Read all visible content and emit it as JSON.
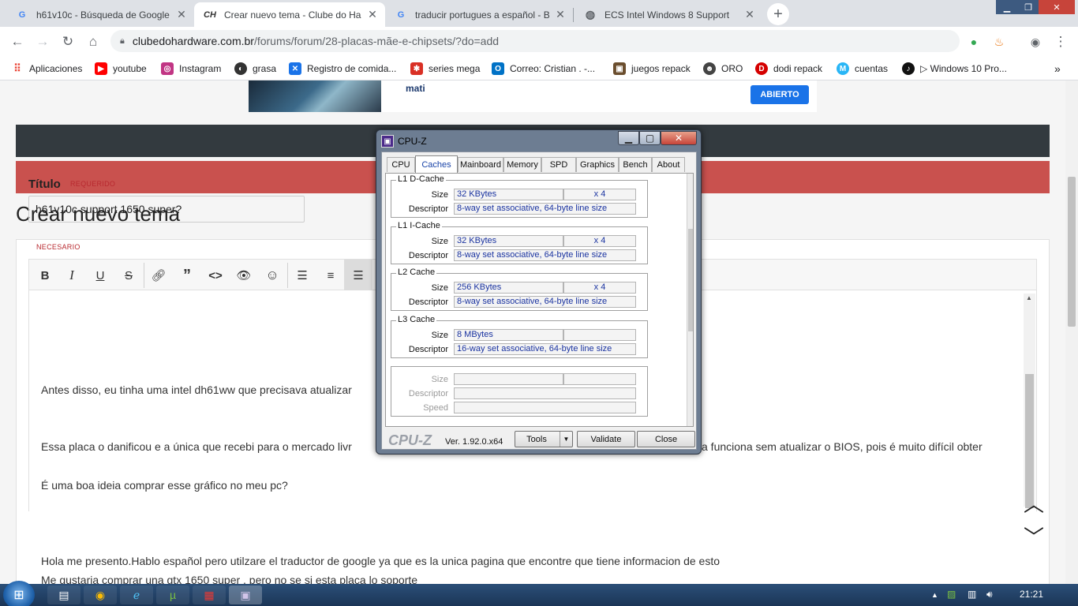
{
  "browser": {
    "tabs": [
      {
        "title": "h61v10c - Búsqueda de Google",
        "icon": "google-icon"
      },
      {
        "title": "Crear nuevo tema - Clube do Hardware",
        "icon": "clube-hardware-icon",
        "fav": "CH"
      },
      {
        "title": "traducir portugues a español - Bu",
        "icon": "google-icon"
      },
      {
        "title": "ECS Intel Windows 8 Support",
        "icon": "globe-icon"
      }
    ],
    "url_host": "clubedohardware.com.br",
    "url_path": "/forums/forum/28-placas-mãe-e-chipsets/?do=add",
    "bookmarks": [
      {
        "label": "Aplicaciones",
        "color": "#ea4335"
      },
      {
        "label": "youtube",
        "color": "#ff0000"
      },
      {
        "label": "Instagram",
        "color": "#c13584"
      },
      {
        "label": "grasa",
        "color": "#333333"
      },
      {
        "label": "Registro de comida...",
        "color": "#1a73e8"
      },
      {
        "label": "series mega",
        "color": "#d93025"
      },
      {
        "label": "Correo: Cristian . -...",
        "color": "#0072c6"
      },
      {
        "label": "juegos repack",
        "color": "#6b4e2e"
      },
      {
        "label": "ORO",
        "color": "#444444"
      },
      {
        "label": "dodi repack",
        "color": "#d50000"
      },
      {
        "label": "cuentas",
        "color": "#29b6f6"
      },
      {
        "label": "▷ Windows 10 Pro...",
        "color": "#111111"
      }
    ]
  },
  "page": {
    "ad_text": "mati",
    "ad_button": "ABIERTO",
    "title": "Crear nuevo tema",
    "field_title_label": "Título",
    "required_label": "REQUERIDO",
    "field_title_value": "h61v10c support 1650 super?",
    "necessary_label": "NECESARIO",
    "editor_paragraphs": [
      "Antes disso, eu tinha uma intel dh61ww que precisava atualizar",
      "Essa placa o danificou e a única que recebi para o mercado livr",
      "É uma boa ideia comprar esse gráfico no meu pc?",
      "Hola me presento.Hablo español pero utilzare el traductor de google ya que es la unica pagina que encontre que tiene informacion de esto",
      "Me gustaria comprar una gtx 1650 super , pero no se si esta placa lo soporte"
    ],
    "editor_paragraph_tail": "a funciona sem atualizar o BIOS, pois é muito difícil obter"
  },
  "cpuz": {
    "title": "CPU-Z",
    "tabs": [
      "CPU",
      "Caches",
      "Mainboard",
      "Memory",
      "SPD",
      "Graphics",
      "Bench",
      "About"
    ],
    "selected_tab": "Caches",
    "groups": [
      {
        "name": "L1 D-Cache",
        "size_label": "Size",
        "size": "32 KBytes",
        "count": "x 4",
        "desc_label": "Descriptor",
        "descriptor": "8-way set associative, 64-byte line size"
      },
      {
        "name": "L1 I-Cache",
        "size_label": "Size",
        "size": "32 KBytes",
        "count": "x 4",
        "desc_label": "Descriptor",
        "descriptor": "8-way set associative, 64-byte line size"
      },
      {
        "name": "L2 Cache",
        "size_label": "Size",
        "size": "256 KBytes",
        "count": "x 4",
        "desc_label": "Descriptor",
        "descriptor": "8-way set associative, 64-byte line size"
      },
      {
        "name": "L3 Cache",
        "size_label": "Size",
        "size": "8 MBytes",
        "count": "",
        "desc_label": "Descriptor",
        "descriptor": "16-way set associative, 64-byte line size"
      }
    ],
    "empty_group": {
      "size_label": "Size",
      "desc_label": "Descriptor",
      "speed_label": "Speed"
    },
    "logo": "CPU-Z",
    "version": "Ver. 1.92.0.x64",
    "buttons": {
      "tools": "Tools",
      "validate": "Validate",
      "close": "Close"
    }
  },
  "taskbar": {
    "time": "21:21"
  }
}
